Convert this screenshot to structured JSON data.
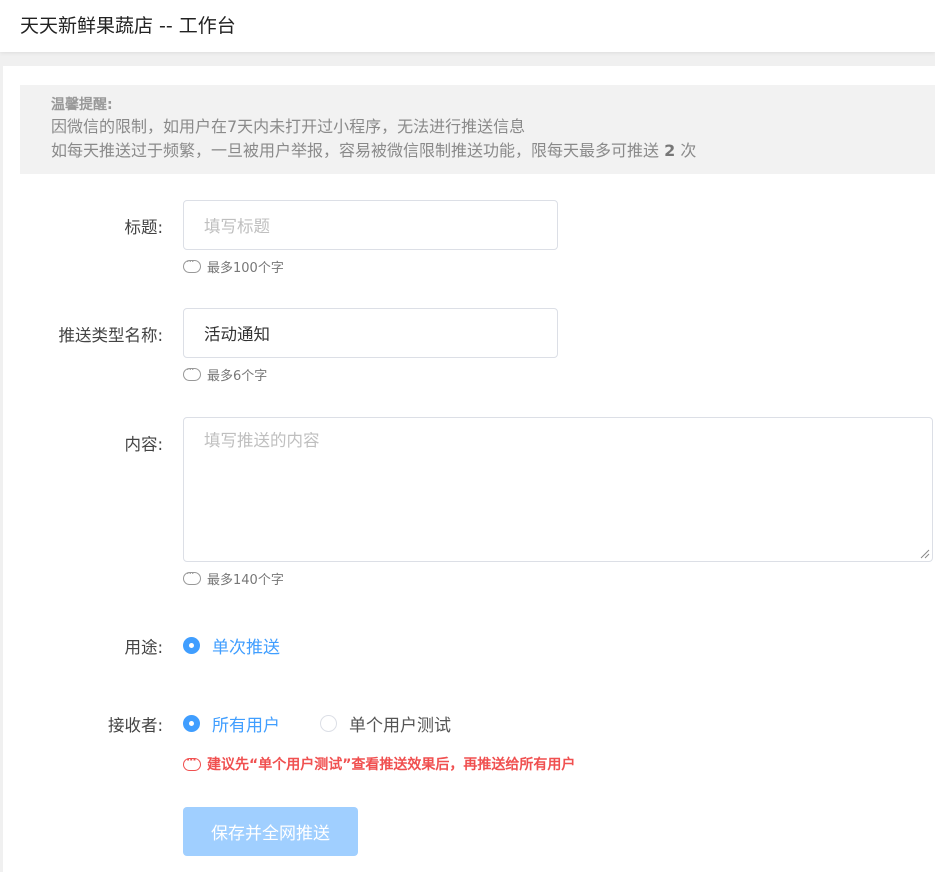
{
  "header": {
    "title": "天天新鲜果蔬店 -- 工作台"
  },
  "notice": {
    "title": "温馨提醒:",
    "line1": "因微信的限制，如用户在7天内未打开过小程序，无法进行推送信息",
    "line2_prefix": "如每天推送过于频繁，一旦被用户举报，容易被微信限制推送功能，限每天最多可推送 ",
    "line2_count": "2",
    "line2_suffix": " 次"
  },
  "form": {
    "title": {
      "label": "标题:",
      "placeholder": "填写标题",
      "hint": "最多100个字"
    },
    "push_type": {
      "label": "推送类型名称:",
      "value": "活动通知",
      "hint": "最多6个字"
    },
    "content": {
      "label": "内容:",
      "placeholder": "填写推送的内容",
      "hint": "最多140个字"
    },
    "usage": {
      "label": "用途:",
      "options": [
        {
          "label": "单次推送",
          "checked": true
        }
      ]
    },
    "receiver": {
      "label": "接收者:",
      "options": [
        {
          "label": "所有用户",
          "checked": true
        },
        {
          "label": "单个用户测试",
          "checked": false
        }
      ],
      "warning": "建议先“单个用户测试”查看推送效果后，再推送给所有用户"
    },
    "submit_label": "保存并全网推送"
  },
  "colors": {
    "primary": "#409eff",
    "primary_disabled": "#a0cfff",
    "warning": "#f05050"
  }
}
